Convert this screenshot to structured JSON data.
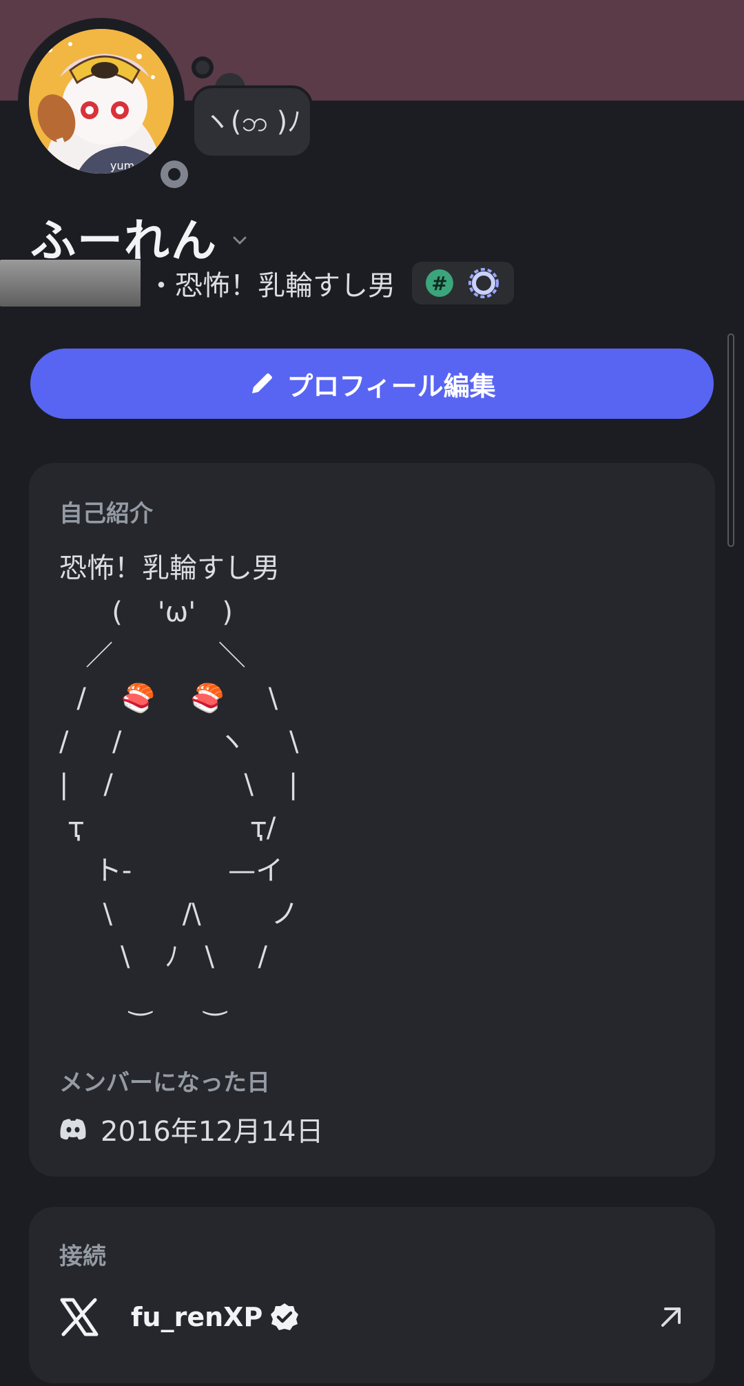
{
  "status_bubble": {
    "text": "ヽ(ဘ )ﾉ"
  },
  "profile": {
    "display_name": "ふーれん",
    "subtitle": "・恐怖！乳輪すし男",
    "badges": [
      "hashtag-badge-icon",
      "laurel-badge-icon"
    ]
  },
  "actions": {
    "edit_profile": "プロフィール編集"
  },
  "bio": {
    "label": "自己紹介",
    "first_line": "恐怖！乳輪すし男",
    "art_lines": [
      "      (    'ω'   )",
      "   ／            ＼",
      "  /    🍣    🍣     \\",
      "/     /           ヽ     \\",
      "|    /               \\    |",
      " ҭ                   ҭ/",
      "    ト-           —イ",
      "     \\        /\\        ノ",
      "       \\    ﾉ   \\     /",
      "        ‿      ‿"
    ]
  },
  "member_since": {
    "label": "メンバーになった日",
    "date": "2016年12月14日",
    "icon": "discord-icon"
  },
  "connections": {
    "label": "接続",
    "items": [
      {
        "service_icon": "x-logo-icon",
        "username": "fu_renXP",
        "verified": true
      }
    ]
  },
  "colors": {
    "banner": "#5a3b47",
    "accent": "#5865f2",
    "background": "#1c1d22",
    "card": "#26272d"
  }
}
